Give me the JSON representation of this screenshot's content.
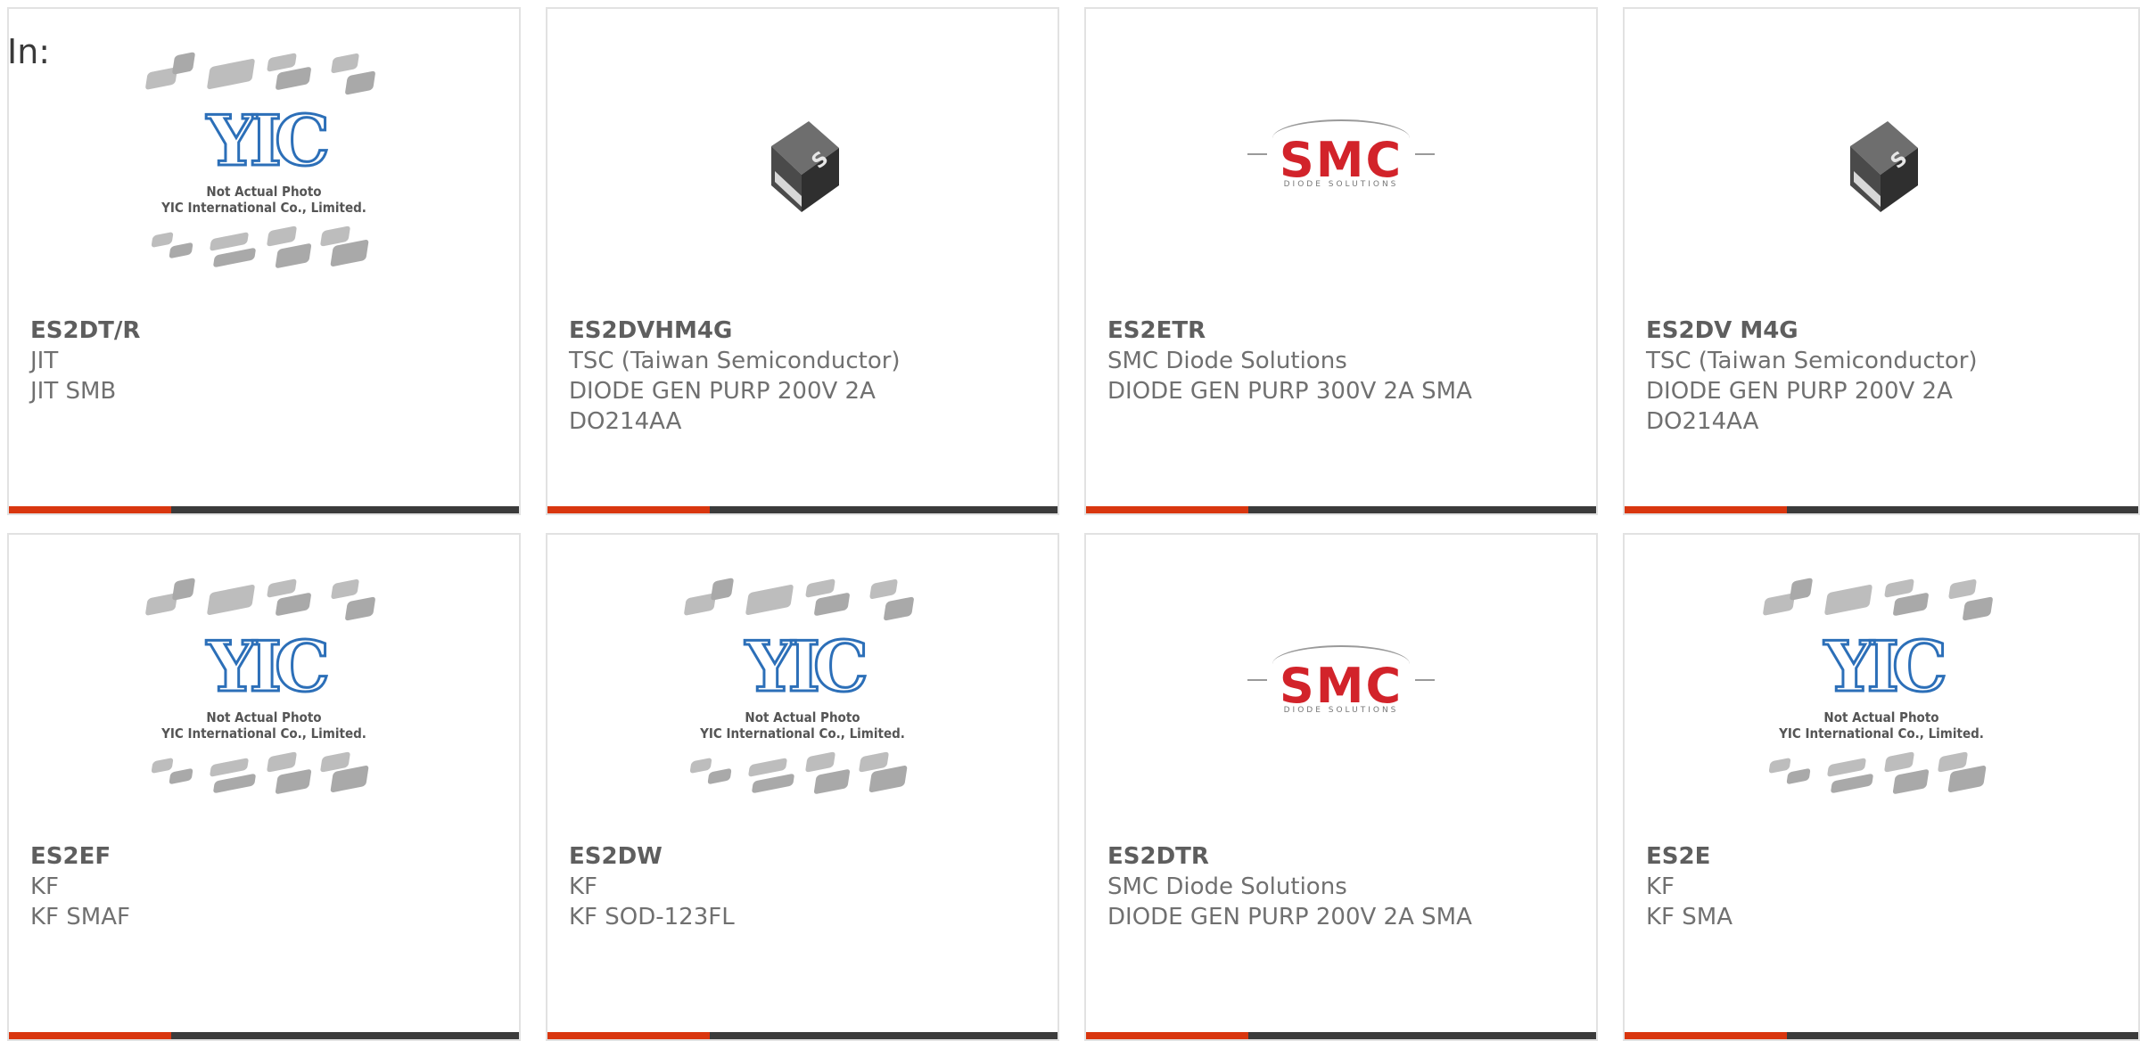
{
  "header": {
    "label": "In:"
  },
  "colors": {
    "accent": "#d9360f",
    "bar": "#3b3b3b",
    "border": "#e2e2e2"
  },
  "cards": [
    {
      "image": "yic-placeholder",
      "part_number": "ES2DT/R",
      "lines": [
        "JIT",
        "JIT SMB"
      ]
    },
    {
      "image": "diode-chip-photo",
      "part_number": "ES2DVHM4G",
      "lines": [
        "TSC (Taiwan Semiconductor)",
        "DIODE GEN PURP 200V 2A",
        "DO214AA"
      ]
    },
    {
      "image": "smc-logo",
      "part_number": "ES2ETR",
      "lines": [
        "SMC Diode Solutions",
        "DIODE GEN PURP 300V 2A SMA"
      ]
    },
    {
      "image": "diode-chip-photo",
      "part_number": "ES2DV M4G",
      "lines": [
        "TSC (Taiwan Semiconductor)",
        "DIODE GEN PURP 200V 2A",
        "DO214AA"
      ]
    },
    {
      "image": "yic-placeholder",
      "part_number": "ES2EF",
      "lines": [
        "KF",
        "KF SMAF"
      ]
    },
    {
      "image": "yic-placeholder",
      "part_number": "ES2DW",
      "lines": [
        "KF",
        "KF SOD-123FL"
      ]
    },
    {
      "image": "smc-logo",
      "part_number": "ES2DTR",
      "lines": [
        "SMC Diode Solutions",
        "DIODE GEN PURP 200V 2A SMA"
      ]
    },
    {
      "image": "yic-placeholder",
      "part_number": "ES2E",
      "lines": [
        "KF",
        "KF SMA"
      ]
    }
  ],
  "yic_placeholder": {
    "logo_text": "YIC",
    "note_line1": "Not Actual Photo",
    "note_line2": "YIC International Co., Limited."
  },
  "smc_logo": {
    "text": "SMC",
    "subtext": "DIODE SOLUTIONS"
  },
  "diode_marking": "S"
}
